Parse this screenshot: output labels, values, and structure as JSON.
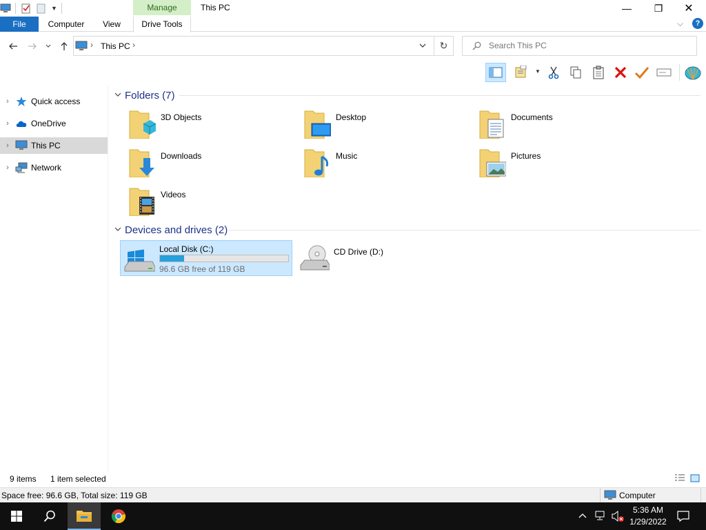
{
  "window": {
    "title": "This PC",
    "context_tab": "Manage",
    "minimize_glyph": "—",
    "maximize_glyph": "❐",
    "close_glyph": "✕"
  },
  "ribbon": {
    "tabs": [
      "File",
      "Computer",
      "View",
      "Drive Tools"
    ],
    "collapse_glyph": "⌵",
    "help_glyph": "?"
  },
  "address": {
    "path": "This PC",
    "separator": "›",
    "dropdown_glyph": "⌵",
    "refresh_glyph": "↻"
  },
  "search": {
    "placeholder": "Search This PC"
  },
  "navigation": {
    "items": [
      {
        "label": "Quick access",
        "icon": "star-icon"
      },
      {
        "label": "OneDrive",
        "icon": "cloud-icon"
      },
      {
        "label": "This PC",
        "icon": "computer-icon",
        "selected": true
      },
      {
        "label": "Network",
        "icon": "network-icon"
      }
    ]
  },
  "folders_group": {
    "title": "Folders (7)",
    "items": [
      {
        "name": "3D Objects",
        "icon": "3d-objects-icon"
      },
      {
        "name": "Desktop",
        "icon": "desktop-folder-icon"
      },
      {
        "name": "Documents",
        "icon": "documents-folder-icon"
      },
      {
        "name": "Downloads",
        "icon": "downloads-folder-icon"
      },
      {
        "name": "Music",
        "icon": "music-folder-icon"
      },
      {
        "name": "Pictures",
        "icon": "pictures-folder-icon"
      },
      {
        "name": "Videos",
        "icon": "videos-folder-icon"
      }
    ]
  },
  "drives_group": {
    "title": "Devices and drives (2)",
    "items": [
      {
        "name": "Local Disk (C:)",
        "free_text": "96.6 GB free of 119 GB",
        "used_fraction": 0.19,
        "selected": true
      },
      {
        "name": "CD Drive (D:)"
      }
    ]
  },
  "status": {
    "item_count": "9 items",
    "selection": "1 item selected"
  },
  "details": {
    "space": "Space free: 96.6 GB, Total size: 119 GB",
    "location": "Computer"
  },
  "taskbar": {
    "time": "5:36 AM",
    "date": "1/29/2022"
  },
  "colors": {
    "accent": "#1a6fc2",
    "selection": "#cce8ff",
    "group_header": "#1e3287",
    "manage_tab": "#d4efc8"
  }
}
